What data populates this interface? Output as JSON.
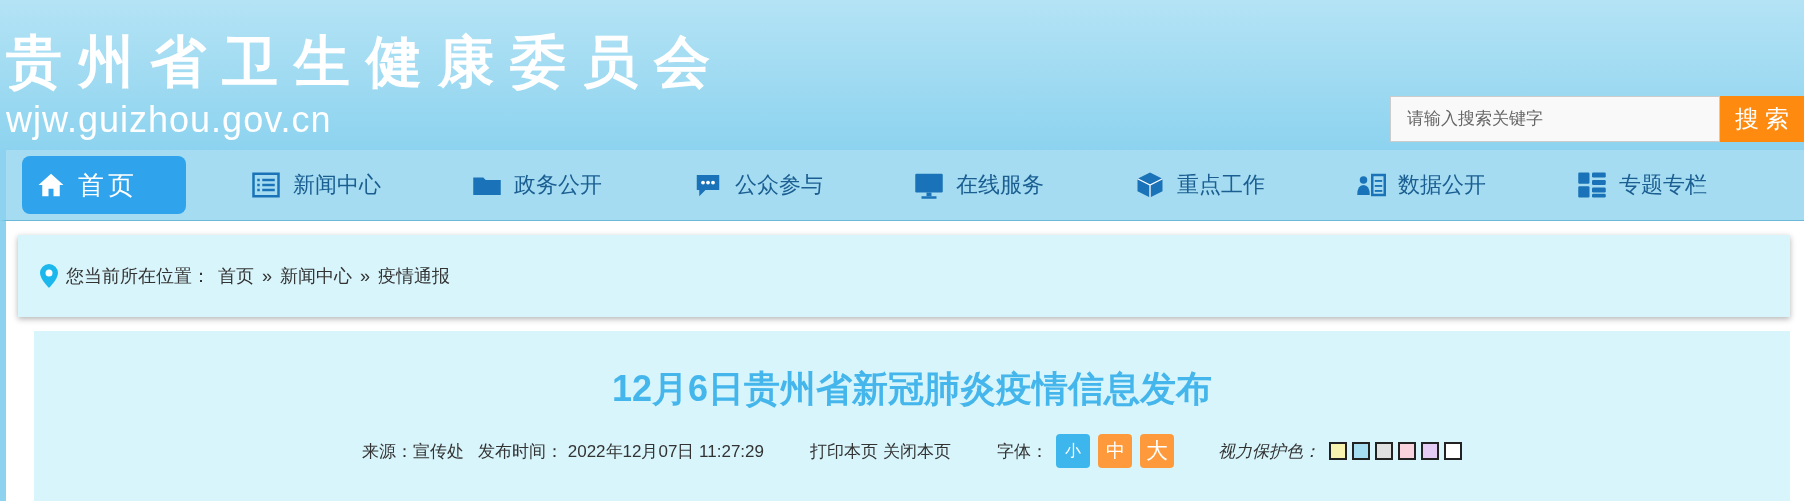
{
  "header": {
    "site_title": "贵州省卫生健康委员会",
    "domain": "wjw.guizhou.gov.cn",
    "search": {
      "placeholder": "请输入搜索关键字",
      "button": "搜 索"
    }
  },
  "nav": [
    {
      "label": "首页",
      "kind": "home",
      "selected": true
    },
    {
      "label": "新闻中心",
      "kind": "list",
      "selected": false
    },
    {
      "label": "政务公开",
      "kind": "folder",
      "selected": false
    },
    {
      "label": "公众参与",
      "kind": "chat",
      "selected": false
    },
    {
      "label": "在线服务",
      "kind": "monitor",
      "selected": false
    },
    {
      "label": "重点工作",
      "kind": "cube",
      "selected": false
    },
    {
      "label": "数据公开",
      "kind": "person-list",
      "selected": false
    },
    {
      "label": "专题专栏",
      "kind": "grid",
      "selected": false
    }
  ],
  "breadcrumb": {
    "prefix": "您当前所在位置：",
    "items": [
      "首页",
      "新闻中心",
      "疫情通报"
    ],
    "separator": "»"
  },
  "article": {
    "title": "12月6日贵州省新冠肺炎疫情信息发布",
    "source": "来源：宣传处",
    "published": "发布时间： 2022年12月07日 11:27:29",
    "print": "打印本页",
    "close": "关闭本页",
    "font_label": "字体：",
    "font_sizes": [
      {
        "label": "小",
        "selected": true
      },
      {
        "label": "中",
        "selected": false
      },
      {
        "label": "大",
        "selected": false
      }
    ],
    "eye_label": "视力保护色：",
    "eye_colors": [
      {
        "color": "#f9f3b0"
      },
      {
        "color": "#a6ddf1"
      },
      {
        "color": "#e0e0e0"
      },
      {
        "color": "#f8d3dd"
      },
      {
        "color": "#e4ccf5"
      },
      {
        "color": "#ffffff"
      }
    ]
  }
}
